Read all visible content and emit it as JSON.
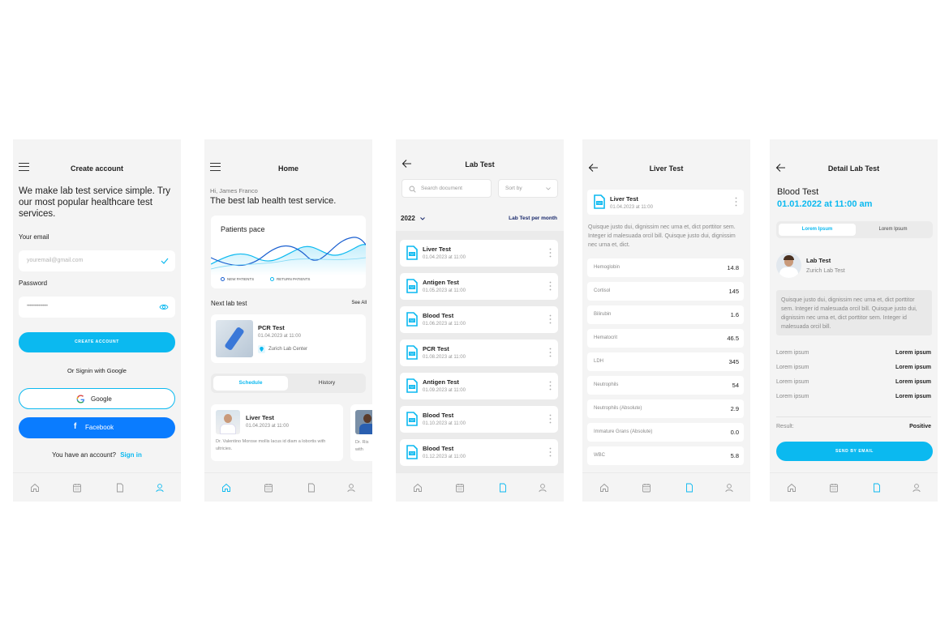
{
  "colors": {
    "accent": "#0bb9f0",
    "facebook": "#0a7cff",
    "background": "#f4f4f4",
    "navy": "#1a2a6c"
  },
  "nav_icons": [
    "home-icon",
    "calendar-icon",
    "document-icon",
    "profile-icon"
  ],
  "screen1": {
    "title": "Create account",
    "headline": "We make lab test service simple. Try our most popular healthcare test services.",
    "email_label": "Your email",
    "email_placeholder": "youremail@gmail.com",
    "password_label": "Password",
    "password_value": "••••••••••••••••",
    "create_button": "CREATE ACCOUNT",
    "or_text": "Or Signin with Google",
    "google_button": "Google",
    "facebook_button": "Facebook",
    "have_account": "You have an account?",
    "signin_link": "Sign in"
  },
  "screen2": {
    "title": "Home",
    "greeting": "Hi, James Franco",
    "headline": "The best lab health test service.",
    "chart_title": "Patients pace",
    "legend_new": "NEW PATIENTS",
    "legend_return": "RETURN PATIENTS",
    "next_label": "Next lab test",
    "see_all": "See All",
    "next_test_name": "PCR Test",
    "next_test_date": "01.04.2023 at 11:00",
    "next_test_location": "Zurich Lab Center",
    "tab_schedule": "Schedule",
    "tab_history": "History",
    "card_title": "Liver Test",
    "card_date": "01.04.2023 at 11:00",
    "card_text": "Dr. Valentino Morose mollis lacus id diam a lobortis with ultricies.",
    "card2_text_a": "Dr. Ris",
    "card2_text_b": "with"
  },
  "screen3": {
    "title": "Lab Test",
    "search_placeholder": "Search document",
    "sort_label": "Sort by",
    "year": "2022",
    "per_month": "Lab Test per month",
    "items": [
      {
        "name": "Liver Test",
        "date": "01.04.2023 at 11:00"
      },
      {
        "name": "Antigen Test",
        "date": "01.05.2023 at 11:00"
      },
      {
        "name": "Blood Test",
        "date": "01.06.2023 at 11:00"
      },
      {
        "name": "PCR Test",
        "date": "01.08.2023 at 11:00"
      },
      {
        "name": "Antigen Test",
        "date": "01.09.2023 at 11:00"
      },
      {
        "name": "Blood Test",
        "date": "01.10.2023 at 11:00"
      },
      {
        "name": "Blood Test",
        "date": "01.12.2023 at 11:00"
      }
    ]
  },
  "screen4": {
    "title": "Liver Test",
    "doc_name": "Liver Test",
    "doc_date": "01.04.2023 at 11:00",
    "description": "Quisque justo dui, dignissim nec urna et, dict porttitor sem. Integer id malesuada orcil bill. Quisque justo dui, dignissim nec urna et, dict.",
    "results": [
      {
        "name": "Hemoglobin",
        "value": "14.8"
      },
      {
        "name": "Cortisol",
        "value": "145"
      },
      {
        "name": "Bilirubin",
        "value": "1.6"
      },
      {
        "name": "Hematocrit",
        "value": "46.5"
      },
      {
        "name": "LDH",
        "value": "345"
      },
      {
        "name": "Neutrophils",
        "value": "54"
      },
      {
        "name": "Neutrophils (Absolute)",
        "value": "2.9"
      },
      {
        "name": "Immature Grans (Absolute)",
        "value": "0.0"
      },
      {
        "name": "WBC",
        "value": "5.8"
      }
    ]
  },
  "screen5": {
    "title": "Detail Lab Test",
    "test_name": "Blood Test",
    "test_date": "01.01.2022 at 11:00 am",
    "tab1": "Lorem Ipsum",
    "tab2": "Lorem Ipsum",
    "doctor_title": "Lab Test",
    "doctor_location": "Zurich Lab Test",
    "note": "Quisque justo dui, dignissim nec urna et, dict porttitor sem. Integer id malesuada orcil bill. Quisque justo dui, dignissim nec urna et, dict porttitor sem. Integer id malesuada orcil bill.",
    "rows": [
      {
        "k": "Lorem ipsum",
        "v": "Lorem ipsum"
      },
      {
        "k": "Lorem ipsum",
        "v": "Lorem ipsum"
      },
      {
        "k": "Lorem ipsum",
        "v": "Lorem ipsum"
      },
      {
        "k": "Lorem ipsum",
        "v": "Lorem ipsum"
      }
    ],
    "result_label": "Result:",
    "result_value": "Positive",
    "send_button": "SEND BY EMAIL"
  }
}
